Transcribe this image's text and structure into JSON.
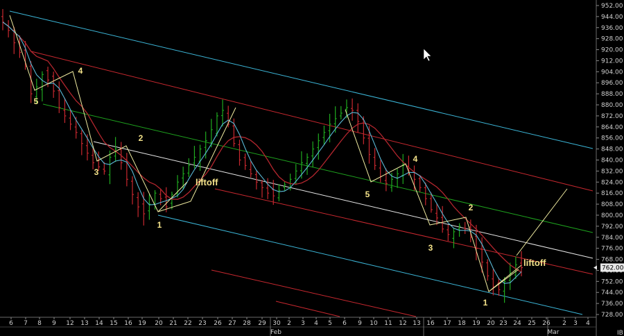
{
  "chart_data": {
    "type": "candlestick",
    "title": "",
    "ylabel": "",
    "xlabel": "",
    "ylim": [
      726,
      954
    ],
    "grid": false,
    "y_ticks": [
      "944.00",
      "936.00",
      "928.00",
      "920.00",
      "912.00",
      "904.00",
      "896.00",
      "888.00",
      "880.00",
      "872.00",
      "864.00",
      "856.00",
      "848.00",
      "840.00",
      "832.00",
      "824.00",
      "816.00",
      "808.00",
      "800.00",
      "792.00",
      "784.00",
      "776.00",
      "768.00",
      "760.00",
      "752.00",
      "744.00",
      "736.00",
      "728.00"
    ],
    "y_top_partial": "952.00",
    "x_ticks": [
      "6",
      "7",
      "8",
      "9",
      "12",
      "13",
      "14",
      "15",
      "16",
      "19",
      "20",
      "21",
      "22",
      "23",
      "26",
      "27",
      "28",
      "29",
      "30",
      "2",
      "3",
      "4",
      "5",
      "6",
      "9",
      "10",
      "11",
      "12",
      "13",
      "16",
      "17",
      "18",
      "19",
      "20",
      "23",
      "24",
      "25",
      "26",
      "2",
      "3",
      "4",
      "5"
    ],
    "month_labels": [
      "Feb",
      "Mar"
    ],
    "last_price": "762.00",
    "corner_label": "IB",
    "colors": {
      "up": "#1faa1f",
      "down": "#c8282f",
      "ma_short": "#5ab9d6",
      "ma_long": "#b3262e",
      "channel_outer": "#3cb6d8",
      "channel_mid_red": "#c8282f",
      "channel_green": "#1ea31e",
      "median": "#e8e8e8",
      "wave": "#f5e38a"
    },
    "series": [
      {
        "name": "close",
        "values": [
          940,
          934,
          925,
          918,
          908,
          888,
          893,
          902,
          898,
          890,
          878,
          872,
          866,
          860,
          852,
          845,
          838,
          835,
          832,
          842,
          848,
          838,
          826,
          815,
          806,
          801,
          808,
          816,
          812,
          806,
          815,
          824,
          830,
          836,
          842,
          848,
          854,
          862,
          872,
          876,
          866,
          852,
          840,
          836,
          830,
          824,
          820,
          816,
          814,
          818,
          822,
          826,
          832,
          838,
          842,
          848,
          854,
          860,
          866,
          870,
          874,
          878,
          876,
          868,
          856,
          844,
          836,
          828,
          823,
          826,
          830,
          836,
          832,
          826,
          820,
          812,
          804,
          798,
          790,
          786,
          788,
          792,
          790,
          784,
          776,
          766,
          756,
          748,
          746,
          752,
          758,
          764,
          762
        ]
      }
    ],
    "wave_labels": [
      {
        "text": "5",
        "x": "8",
        "y": 884
      },
      {
        "text": "4",
        "x": "12",
        "y": 902
      },
      {
        "text": "3",
        "x": "14",
        "y": 834
      },
      {
        "text": "2",
        "x": "19",
        "y": 848
      },
      {
        "text": "1",
        "x": "21",
        "y": 794
      },
      {
        "text": "liftoff",
        "x": "26",
        "y": 818
      },
      {
        "text": "5",
        "x": "10",
        "y": 818
      },
      {
        "text": "4",
        "x": "16",
        "y": 838
      },
      {
        "text": "3",
        "x": "17",
        "y": 780
      },
      {
        "text": "2",
        "x": "20",
        "y": 794
      },
      {
        "text": "1",
        "x": "23",
        "y": 734
      },
      {
        "text": "liftoff",
        "x": "26",
        "y": 759
      }
    ]
  }
}
